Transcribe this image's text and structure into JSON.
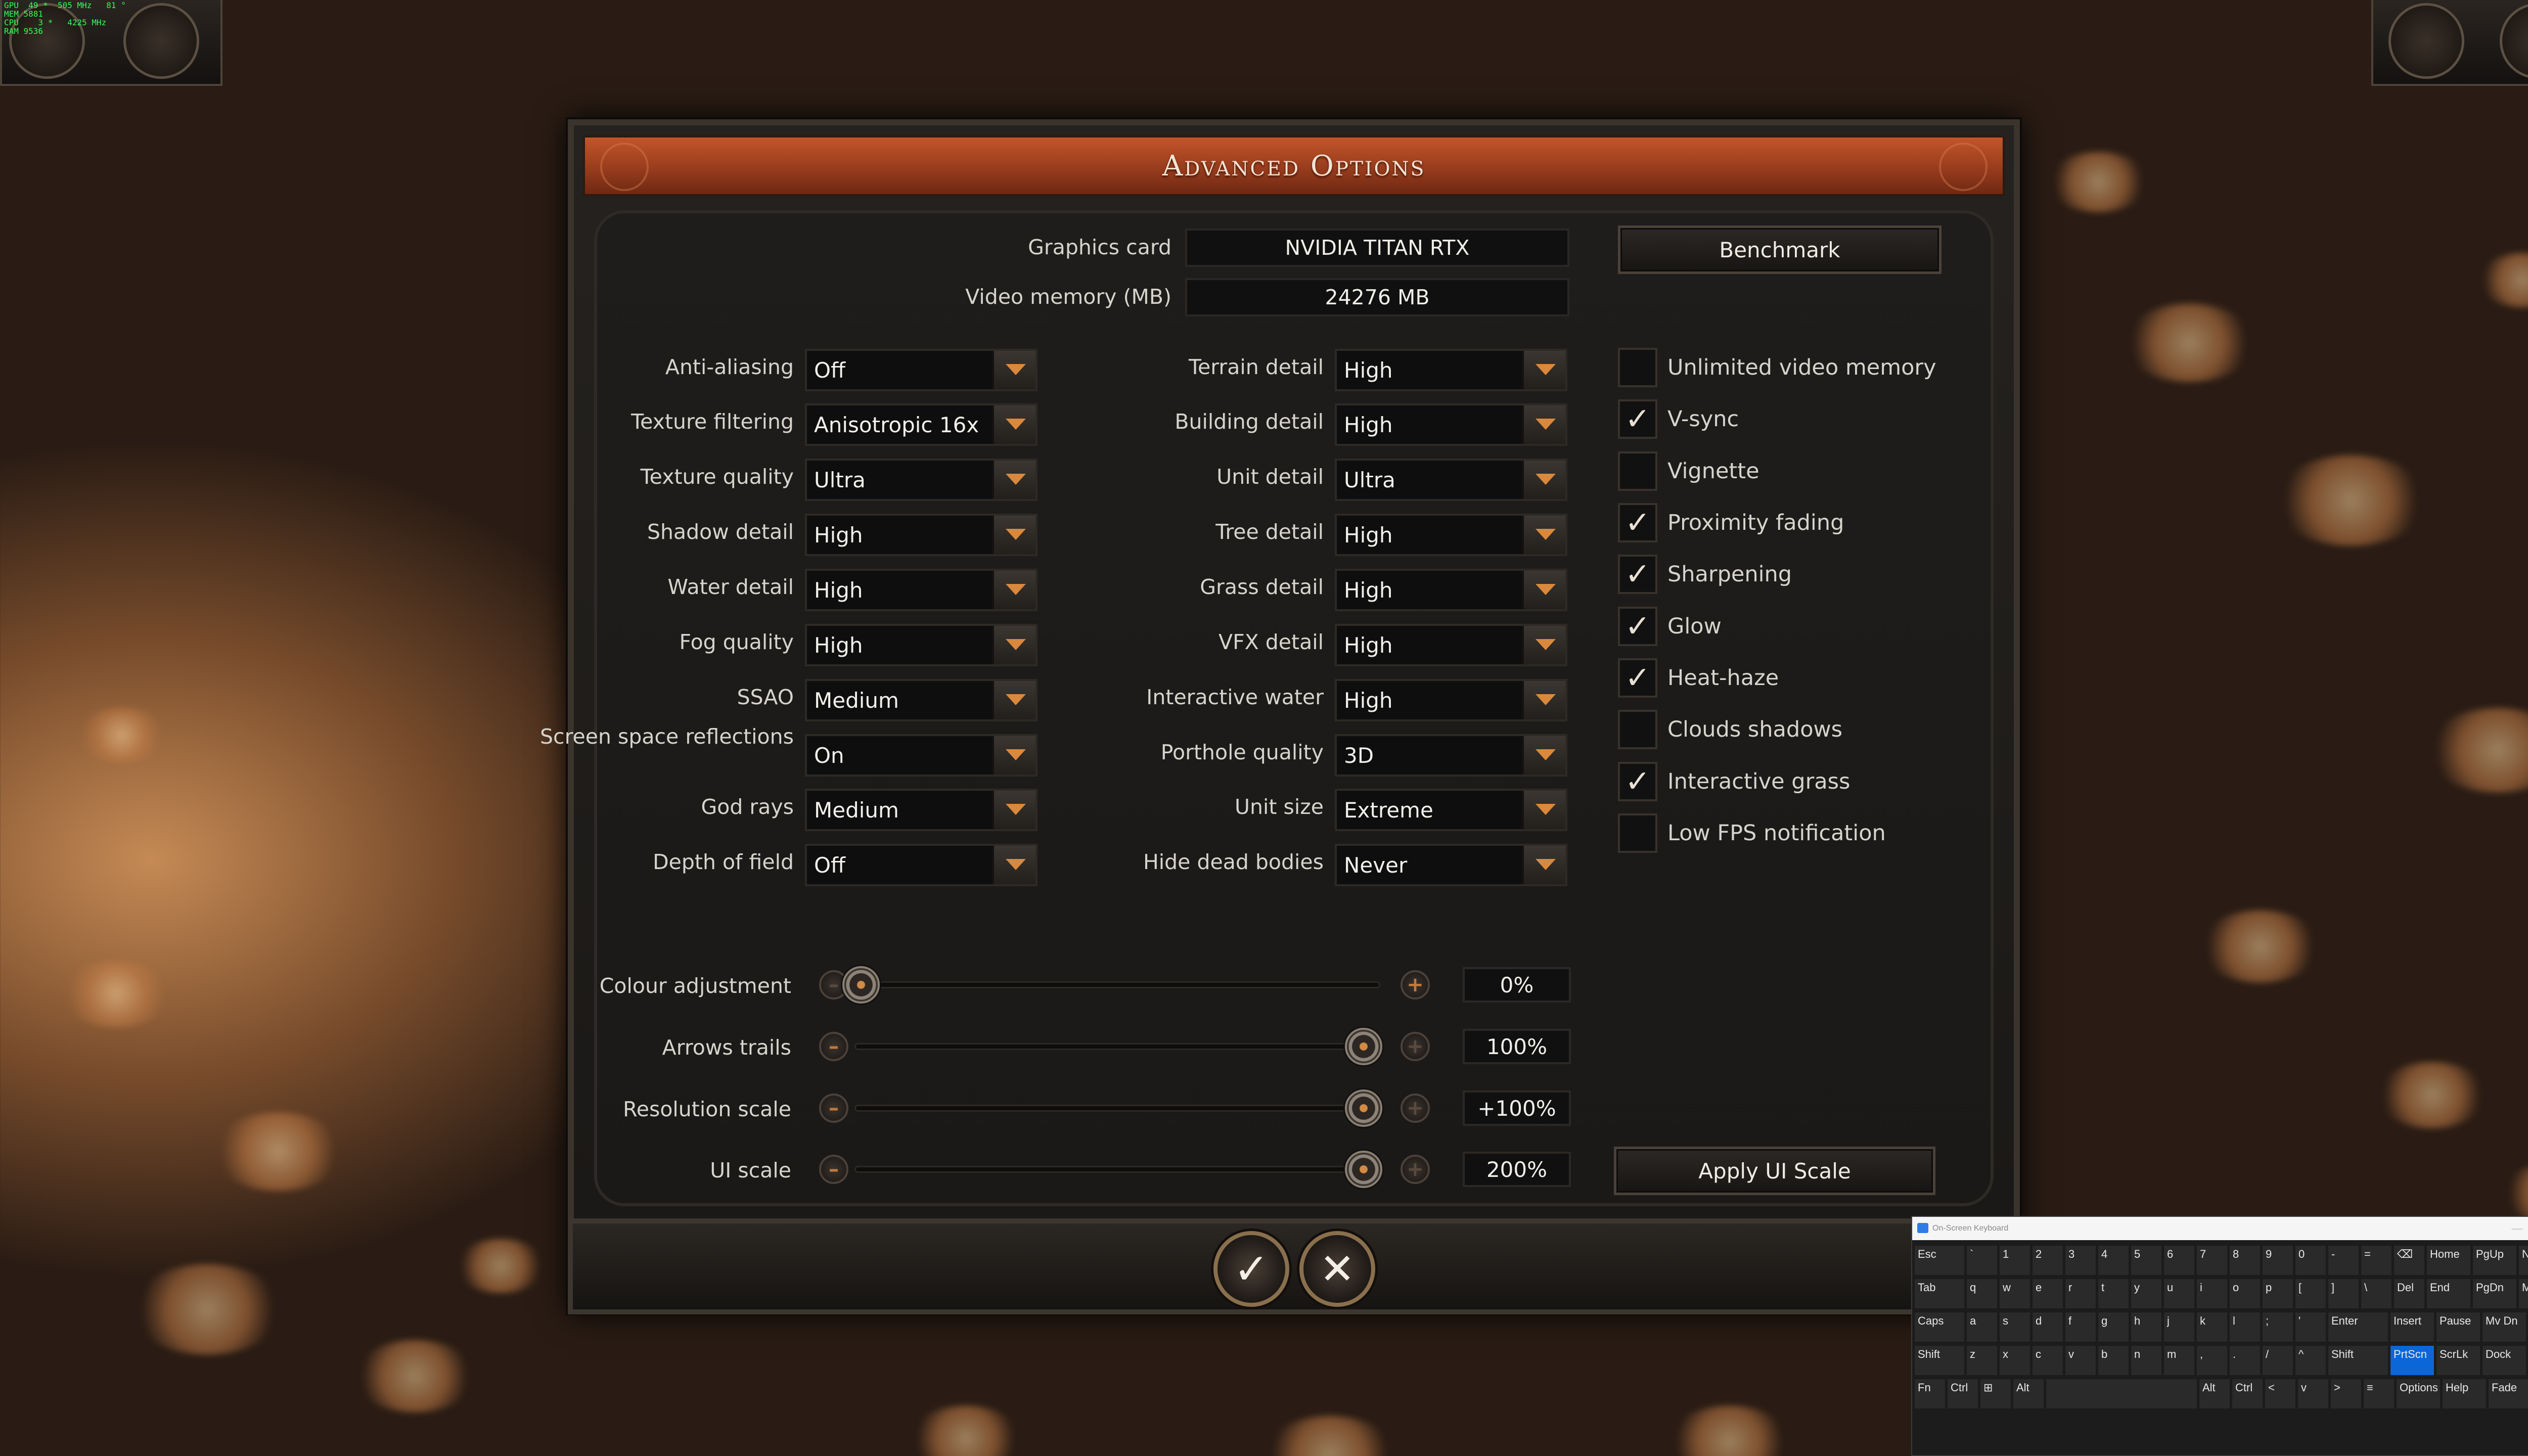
{
  "hud": {
    "fps_overlay": "GPU  49 *  505 MHz   81 °\nMEM 5881\nCPU    3 *   4225 MHz\nRAM 9536"
  },
  "title": "Advanced Options",
  "gpu": {
    "graphics_card_label": "Graphics card",
    "graphics_card_value": "NVIDIA TITAN RTX",
    "video_memory_label": "Video memory (MB)",
    "video_memory_value": "24276 MB",
    "benchmark_label": "Benchmark"
  },
  "left_settings": [
    {
      "label": "Anti-aliasing",
      "value": "Off"
    },
    {
      "label": "Texture filtering",
      "value": "Anisotropic 16x"
    },
    {
      "label": "Texture quality",
      "value": "Ultra"
    },
    {
      "label": "Shadow detail",
      "value": "High"
    },
    {
      "label": "Water detail",
      "value": "High"
    },
    {
      "label": "Fog quality",
      "value": "High"
    },
    {
      "label": "SSAO",
      "value": "Medium"
    },
    {
      "label": "Screen space reflections",
      "value": "On"
    },
    {
      "label": "God rays",
      "value": "Medium"
    },
    {
      "label": "Depth of field",
      "value": "Off"
    }
  ],
  "mid_settings": [
    {
      "label": "Terrain detail",
      "value": "High"
    },
    {
      "label": "Building detail",
      "value": "High"
    },
    {
      "label": "Unit detail",
      "value": "Ultra"
    },
    {
      "label": "Tree detail",
      "value": "High"
    },
    {
      "label": "Grass detail",
      "value": "High"
    },
    {
      "label": "VFX detail",
      "value": "High"
    },
    {
      "label": "Interactive water",
      "value": "High"
    },
    {
      "label": "Porthole quality",
      "value": "3D"
    },
    {
      "label": "Unit size",
      "value": "Extreme"
    },
    {
      "label": "Hide dead bodies",
      "value": "Never"
    }
  ],
  "checkboxes": [
    {
      "label": "Unlimited video memory",
      "checked": false
    },
    {
      "label": "V-sync",
      "checked": true
    },
    {
      "label": "Vignette",
      "checked": false
    },
    {
      "label": "Proximity fading",
      "checked": true
    },
    {
      "label": "Sharpening",
      "checked": true
    },
    {
      "label": "Glow",
      "checked": true
    },
    {
      "label": "Heat-haze",
      "checked": true
    },
    {
      "label": "Clouds shadows",
      "checked": false
    },
    {
      "label": "Interactive grass",
      "checked": true
    },
    {
      "label": "Low FPS notification",
      "checked": false
    }
  ],
  "check_mark": "✓",
  "sliders": [
    {
      "label": "Colour adjustment",
      "value": "0%",
      "fraction": 0.0
    },
    {
      "label": "Arrows trails",
      "value": "100%",
      "fraction": 1.0
    },
    {
      "label": "Resolution scale",
      "value": "+100%",
      "fraction": 1.0
    },
    {
      "label": "UI scale",
      "value": "200%",
      "fraction": 1.0
    }
  ],
  "slider_minus": "–",
  "slider_plus": "+",
  "apply_ui_scale_label": "Apply UI Scale",
  "confirm_glyph": "✓",
  "cancel_glyph": "✕",
  "osk": {
    "title": "On-Screen Keyboard",
    "rows": [
      [
        "Esc",
        "`",
        "1",
        "2",
        "3",
        "4",
        "5",
        "6",
        "7",
        "8",
        "9",
        "0",
        "-",
        "=",
        "⌫",
        "Home",
        "PgUp",
        "Nav"
      ],
      [
        "Tab",
        "q",
        "w",
        "e",
        "r",
        "t",
        "y",
        "u",
        "i",
        "o",
        "p",
        "[",
        "]",
        "\\",
        "Del",
        "End",
        "PgDn",
        "Mv Up"
      ],
      [
        "Caps",
        "a",
        "s",
        "d",
        "f",
        "g",
        "h",
        "j",
        "k",
        "l",
        ";",
        "'",
        "Enter",
        "Insert",
        "Pause",
        "Mv Dn"
      ],
      [
        "Shift",
        "z",
        "x",
        "c",
        "v",
        "b",
        "n",
        "m",
        ",",
        ".",
        "/",
        "^",
        "Shift",
        "PrtScn",
        "ScrLk",
        "Dock"
      ],
      [
        "Fn",
        "Ctrl",
        "⊞",
        "Alt",
        "",
        "Alt",
        "Ctrl",
        "<",
        "v",
        ">",
        "≡",
        "Options",
        "Help",
        "Fade"
      ]
    ],
    "highlighted": "PrtScn"
  },
  "colors": {
    "title_bar": "#a8441f",
    "accent_orange": "#d9893d",
    "panel": "#1e1c1a",
    "osk_highlight": "#0b66d8"
  }
}
